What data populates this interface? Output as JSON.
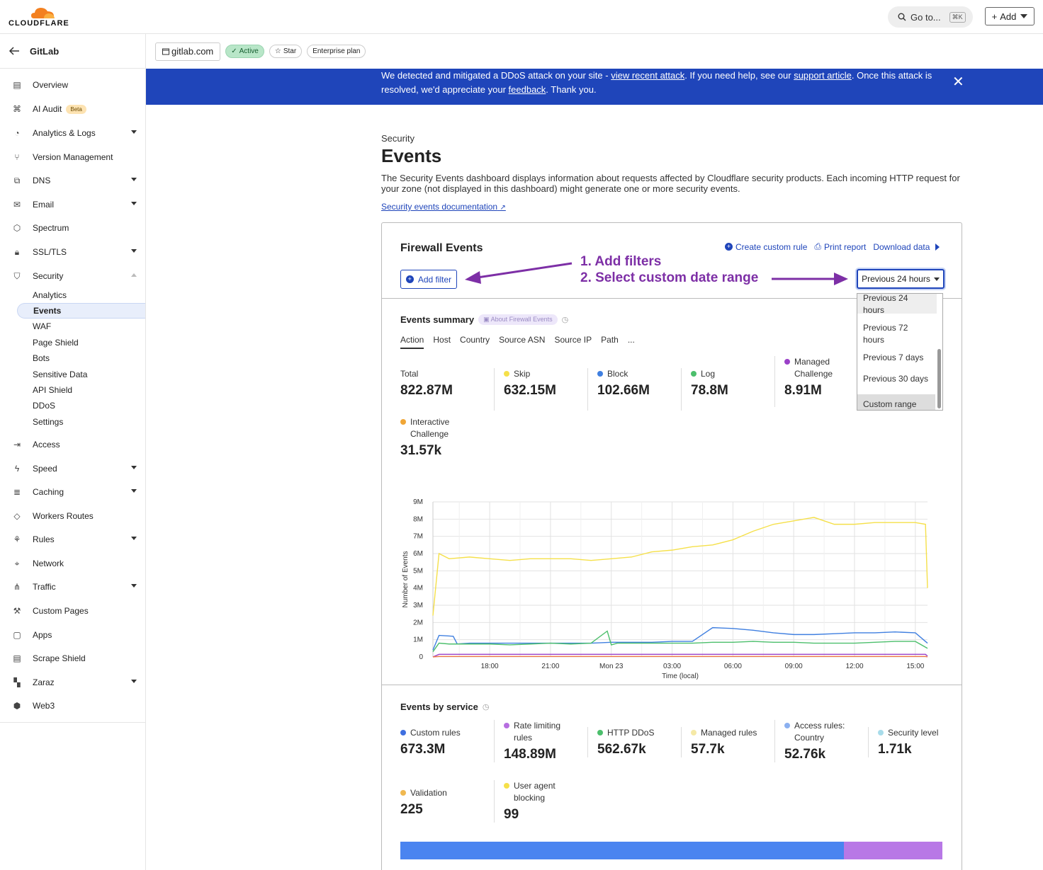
{
  "topbar": {
    "logo_text": "CLOUDFLARE",
    "goto_label": "Go to...",
    "goto_shortcut": "⌘K",
    "add_label": "Add"
  },
  "account": {
    "back_icon": "arrow-left-icon",
    "name": "GitLab"
  },
  "sidebar": {
    "items": [
      {
        "label": "Overview",
        "icon": "document-icon"
      },
      {
        "label": "AI Audit",
        "icon": "ai-audit-icon",
        "badge": "Beta"
      },
      {
        "label": "Analytics & Logs",
        "icon": "chart-icon",
        "expandable": true
      },
      {
        "label": "Version Management",
        "icon": "branch-icon"
      },
      {
        "label": "DNS",
        "icon": "network-tree-icon",
        "expandable": true
      },
      {
        "label": "Email",
        "icon": "envelope-icon",
        "expandable": true
      },
      {
        "label": "Spectrum",
        "icon": "shield-hex-icon"
      },
      {
        "label": "SSL/TLS",
        "icon": "lock-icon",
        "expandable": true
      },
      {
        "label": "Security",
        "icon": "shield-icon",
        "expanded": true
      },
      {
        "label": "Access",
        "icon": "login-icon"
      },
      {
        "label": "Speed",
        "icon": "lightning-icon",
        "expandable": true
      },
      {
        "label": "Caching",
        "icon": "stack-icon",
        "expandable": true
      },
      {
        "label": "Workers Routes",
        "icon": "workers-icon"
      },
      {
        "label": "Rules",
        "icon": "rules-icon",
        "expandable": true
      },
      {
        "label": "Network",
        "icon": "location-pin-icon"
      },
      {
        "label": "Traffic",
        "icon": "traffic-icon",
        "expandable": true
      },
      {
        "label": "Custom Pages",
        "icon": "wrench-icon"
      },
      {
        "label": "Apps",
        "icon": "apps-icon"
      },
      {
        "label": "Scrape Shield",
        "icon": "scrape-icon"
      },
      {
        "label": "Zaraz",
        "icon": "zaraz-icon",
        "expandable": true
      },
      {
        "label": "Web3",
        "icon": "web3-icon"
      }
    ],
    "security_sub": [
      "Analytics",
      "Events",
      "WAF",
      "Page Shield",
      "Bots",
      "Sensitive Data",
      "API Shield",
      "DDoS",
      "Settings"
    ],
    "active_sub": "Events"
  },
  "zone": {
    "name": "gitlab.com",
    "status": "Active",
    "star": "Star",
    "plan": "Enterprise plan"
  },
  "banner": {
    "t1": "We detected and mitigated a DDoS attack on your site - ",
    "link1": "view recent attack",
    "t2": ". If you need help, see our ",
    "link2": "support article",
    "t3": ". Once this attack is resolved, we'd appreciate your ",
    "link3": "feedback",
    "t4": ". Thank you."
  },
  "page": {
    "crumb": "Security",
    "title": "Events",
    "description": "The Security Events dashboard displays information about requests affected by Cloudflare security products. Each incoming HTTP request for your zone (not displayed in this dashboard) might generate one or more security events.",
    "doc_link": "Security events documentation"
  },
  "firewall": {
    "title": "Firewall Events",
    "create_rule": "Create custom rule",
    "print_report": "Print report",
    "download": "Download data",
    "add_filter": "Add filter",
    "annotation1": "1. Add filters",
    "annotation2": "2. Select custom date range",
    "date_selected": "Previous 24 hours",
    "date_options": [
      "Previous 24 hours",
      "Previous 72 hours",
      "Previous 7 days",
      "Previous 30 days",
      "Custom range"
    ],
    "date_highlighted": "Custom range"
  },
  "summary": {
    "title": "Events summary",
    "about": "About Firewall Events",
    "tabs": [
      "Action",
      "Host",
      "Country",
      "Source ASN",
      "Source IP",
      "Path",
      "..."
    ],
    "metrics": [
      {
        "label": "Total",
        "value": "822.87M",
        "color": ""
      },
      {
        "label": "Skip",
        "value": "632.15M",
        "color": "#f5e04a"
      },
      {
        "label": "Block",
        "value": "102.66M",
        "color": "#3f7fe0"
      },
      {
        "label": "Log",
        "value": "78.8M",
        "color": "#4cbf6c"
      },
      {
        "label": "Managed Challenge",
        "value": "8.91M",
        "color": "#9a40c8"
      },
      {
        "label": "Interactive Challenge",
        "value": "31.57k",
        "color": "#f0a636"
      }
    ]
  },
  "chart_data": {
    "type": "line",
    "xlabel": "Time (local)",
    "ylabel": "Number of Events",
    "x_ticks": [
      "18:00",
      "21:00",
      "Mon 23",
      "03:00",
      "06:00",
      "09:00",
      "12:00",
      "15:00"
    ],
    "y_ticks": [
      "0",
      "1M",
      "2M",
      "3M",
      "4M",
      "5M",
      "6M",
      "7M",
      "8M",
      "9M"
    ],
    "ylim": [
      0,
      9000000
    ],
    "x_range_hours": [
      15.2,
      39.6
    ],
    "series": [
      {
        "color": "#f5e04a",
        "x": [
          15.2,
          15.5,
          16,
          17,
          18,
          19,
          20,
          21,
          22,
          23,
          24,
          25,
          26,
          27,
          28,
          29,
          30,
          31,
          32,
          33,
          34,
          35,
          36,
          37,
          38,
          39,
          39.5,
          39.6
        ],
        "y": [
          2400000,
          6000000,
          5700000,
          5800000,
          5700000,
          5600000,
          5700000,
          5700000,
          5700000,
          5600000,
          5700000,
          5800000,
          6100000,
          6200000,
          6400000,
          6500000,
          6800000,
          7300000,
          7700000,
          7900000,
          8100000,
          7700000,
          7700000,
          7800000,
          7800000,
          7800000,
          7700000,
          4000000
        ]
      },
      {
        "color": "#3f7fe0",
        "x": [
          15.2,
          15.5,
          16.2,
          16.4,
          17,
          18,
          19,
          20,
          21,
          22,
          23,
          24,
          25,
          26,
          27,
          28,
          29,
          30,
          31,
          32,
          33,
          34,
          35,
          36,
          37,
          38,
          39,
          39.6
        ],
        "y": [
          400000,
          1250000,
          1200000,
          750000,
          800000,
          800000,
          800000,
          800000,
          800000,
          800000,
          800000,
          850000,
          850000,
          850000,
          900000,
          900000,
          1700000,
          1650000,
          1550000,
          1400000,
          1300000,
          1300000,
          1350000,
          1400000,
          1400000,
          1450000,
          1400000,
          800000
        ]
      },
      {
        "color": "#4cbf6c",
        "x": [
          15.2,
          15.5,
          16,
          17,
          18,
          19,
          20,
          21,
          22,
          23,
          23.8,
          24,
          24.3,
          25,
          26,
          27,
          28,
          29,
          30,
          31,
          32,
          33,
          34,
          35,
          36,
          37,
          38,
          39,
          39.6
        ],
        "y": [
          300000,
          800000,
          750000,
          750000,
          750000,
          700000,
          750000,
          800000,
          750000,
          800000,
          1500000,
          700000,
          800000,
          800000,
          800000,
          800000,
          800000,
          850000,
          850000,
          900000,
          850000,
          850000,
          800000,
          800000,
          800000,
          850000,
          900000,
          900000,
          500000
        ]
      },
      {
        "color": "#9a40c8",
        "x": [
          15.2,
          15.5,
          39.5,
          39.6
        ],
        "y": [
          0,
          150000,
          150000,
          50000
        ]
      },
      {
        "color": "#f07a4a",
        "x": [
          15.2,
          15.5,
          39.5,
          39.6
        ],
        "y": [
          0,
          30000,
          30000,
          0
        ]
      }
    ]
  },
  "services": {
    "title": "Events by service",
    "metrics": [
      {
        "label": "Custom rules",
        "value": "673.3M",
        "color": "#3f6fe0"
      },
      {
        "label": "Rate limiting rules",
        "value": "148.89M",
        "color": "#b66ee0"
      },
      {
        "label": "HTTP DDoS",
        "value": "562.67k",
        "color": "#4cbf6c"
      },
      {
        "label": "Managed rules",
        "value": "57.7k",
        "color": "#f5e9a6"
      },
      {
        "label": "Access rules: Country",
        "value": "52.76k",
        "color": "#8bb0f0"
      },
      {
        "label": "Security level",
        "value": "1.71k",
        "color": "#a8dcea"
      },
      {
        "label": "Validation",
        "value": "225",
        "color": "#f0b850"
      },
      {
        "label": "User agent blocking",
        "value": "99",
        "color": "#f5e04a"
      }
    ],
    "bar": [
      {
        "name": "Custom rules",
        "value": 673.3,
        "color": "#4a84f0"
      },
      {
        "name": "Rate limiting rules",
        "value": 148.89,
        "color": "#b878e6"
      }
    ]
  }
}
